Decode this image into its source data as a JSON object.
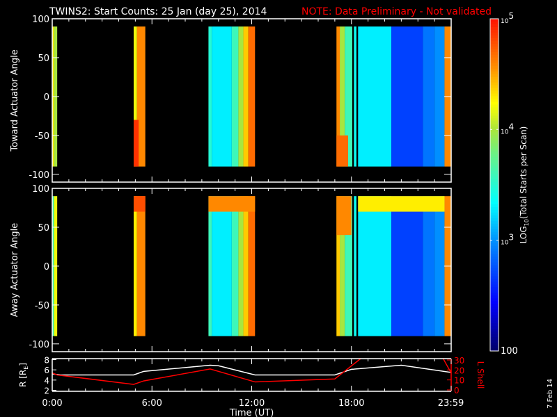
{
  "title": "TWINS2: Start Counts: 25 Jan (day  25), 2014",
  "note": "NOTE: Data Preliminary - Not validated",
  "date_stamp": "7 Feb 14",
  "colors": {
    "background": "#000000",
    "axes": "#ffffff",
    "note": "#ff0000",
    "l_shell": "#ff0000",
    "r_line": "#ffffff"
  },
  "chart_data": [
    {
      "type": "heatmap",
      "name": "toward",
      "ylabel": "Toward Actuator Angle",
      "ylim": [
        -110,
        100
      ],
      "yticks": [
        100,
        50,
        0,
        -50,
        -100
      ],
      "xlim": [
        0,
        24
      ],
      "strips_format": "[t_start_h, t_end_h, angle_min, angle_max, log10_counts]",
      "strips": [
        [
          0.0,
          0.1,
          -90,
          90,
          4.3
        ],
        [
          0.1,
          0.3,
          -90,
          90,
          4.0
        ],
        [
          4.9,
          5.1,
          -90,
          90,
          4.2
        ],
        [
          5.1,
          5.6,
          -90,
          90,
          4.6
        ],
        [
          4.9,
          5.2,
          -90,
          -30,
          4.9
        ],
        [
          9.4,
          9.6,
          -90,
          90,
          3.5
        ],
        [
          9.6,
          10.8,
          -90,
          90,
          3.3
        ],
        [
          10.8,
          11.2,
          -90,
          90,
          3.6
        ],
        [
          11.2,
          11.5,
          -90,
          90,
          4.0
        ],
        [
          11.5,
          11.8,
          -90,
          90,
          4.4
        ],
        [
          11.8,
          12.2,
          -90,
          90,
          4.7
        ],
        [
          17.1,
          17.3,
          -90,
          90,
          4.6
        ],
        [
          17.3,
          17.6,
          -90,
          90,
          4.0
        ],
        [
          17.6,
          18.05,
          -90,
          90,
          3.6
        ],
        [
          17.1,
          17.8,
          -90,
          -50,
          4.7
        ],
        [
          18.15,
          18.3,
          -90,
          90,
          3.4
        ],
        [
          18.4,
          20.4,
          -90,
          90,
          3.3
        ],
        [
          20.4,
          22.3,
          -90,
          90,
          2.7
        ],
        [
          22.3,
          23.0,
          -90,
          90,
          2.9
        ],
        [
          23.0,
          23.6,
          -90,
          90,
          3.0
        ],
        [
          23.6,
          24.0,
          -90,
          90,
          4.6
        ]
      ]
    },
    {
      "type": "heatmap",
      "name": "away",
      "ylabel": "Away Actuator Angle",
      "ylim": [
        -110,
        100
      ],
      "yticks": [
        100,
        50,
        0,
        -50,
        -100
      ],
      "xlim": [
        0,
        24
      ],
      "strips_format": "[t_start_h, t_end_h, angle_min, angle_max, log10_counts]",
      "strips": [
        [
          0.0,
          0.1,
          -90,
          90,
          3.6
        ],
        [
          0.1,
          0.3,
          -90,
          90,
          4.2
        ],
        [
          4.9,
          5.1,
          -90,
          90,
          4.3
        ],
        [
          5.1,
          5.6,
          -90,
          90,
          4.6
        ],
        [
          4.9,
          5.6,
          70,
          90,
          4.8
        ],
        [
          9.4,
          9.6,
          -90,
          90,
          3.6
        ],
        [
          9.6,
          10.8,
          -90,
          90,
          3.3
        ],
        [
          10.8,
          11.2,
          -90,
          90,
          3.6
        ],
        [
          11.2,
          11.5,
          -90,
          90,
          4.0
        ],
        [
          11.5,
          11.8,
          -90,
          90,
          4.4
        ],
        [
          11.8,
          12.2,
          -90,
          90,
          4.7
        ],
        [
          9.4,
          12.2,
          70,
          90,
          4.6
        ],
        [
          17.1,
          17.3,
          -90,
          90,
          4.4
        ],
        [
          17.3,
          17.6,
          -90,
          90,
          4.0
        ],
        [
          17.6,
          18.05,
          -90,
          90,
          3.6
        ],
        [
          17.1,
          18.0,
          40,
          90,
          4.6
        ],
        [
          18.15,
          18.3,
          -90,
          90,
          3.4
        ],
        [
          18.4,
          20.4,
          -90,
          90,
          3.3
        ],
        [
          20.4,
          22.3,
          -90,
          90,
          2.7
        ],
        [
          22.3,
          23.0,
          -90,
          90,
          2.9
        ],
        [
          23.0,
          23.6,
          -90,
          90,
          3.0
        ],
        [
          23.6,
          24.0,
          -90,
          90,
          4.6
        ],
        [
          18.4,
          23.6,
          70,
          90,
          4.3
        ]
      ]
    },
    {
      "type": "line",
      "name": "orbit",
      "ylabel": "R [R",
      "ylabel_sub": "E",
      "ylabel_close": "]",
      "y2label": "L Shell",
      "ylim": [
        1.8,
        8.2
      ],
      "yticks": [
        8,
        6,
        4,
        2
      ],
      "y2lim": [
        0,
        30
      ],
      "y2ticks": [
        30,
        20,
        10,
        0
      ],
      "xlabel": "Time (UT)",
      "xticks": [
        {
          "value": 0,
          "label": "0:00"
        },
        {
          "value": 6,
          "label": "6:00"
        },
        {
          "value": 12,
          "label": "12:00"
        },
        {
          "value": 18,
          "label": "18:00"
        },
        {
          "value": 23.98,
          "label": "23:59"
        }
      ],
      "series": [
        {
          "name": "R",
          "axis": "left",
          "x": [
            0,
            0.5,
            4.9,
            5.5,
            9.5,
            10,
            12.2,
            17,
            18,
            21,
            24
          ],
          "y": [
            5.2,
            5.0,
            5.0,
            5.7,
            6.9,
            6.8,
            5.0,
            5.0,
            6.1,
            6.9,
            5.5
          ]
        },
        {
          "name": "L Shell",
          "axis": "right",
          "x": [
            0,
            0.3,
            4.9,
            5.5,
            9.5,
            12.2,
            17,
            18.6,
            23.5,
            24
          ],
          "y": [
            17,
            15,
            5.5,
            9,
            21,
            8,
            11,
            32,
            32,
            17
          ]
        }
      ]
    }
  ],
  "colorbar": {
    "label": "LOG",
    "label_sub": "10",
    "label_rest": "(Total Starts per Scan)",
    "range_log": [
      2,
      5
    ],
    "ticks": [
      {
        "base": "10",
        "exp": "5"
      },
      {
        "base": "10",
        "exp": "4"
      },
      {
        "base": "10",
        "exp": "3"
      },
      {
        "base": "100",
        "exp": ""
      }
    ]
  }
}
